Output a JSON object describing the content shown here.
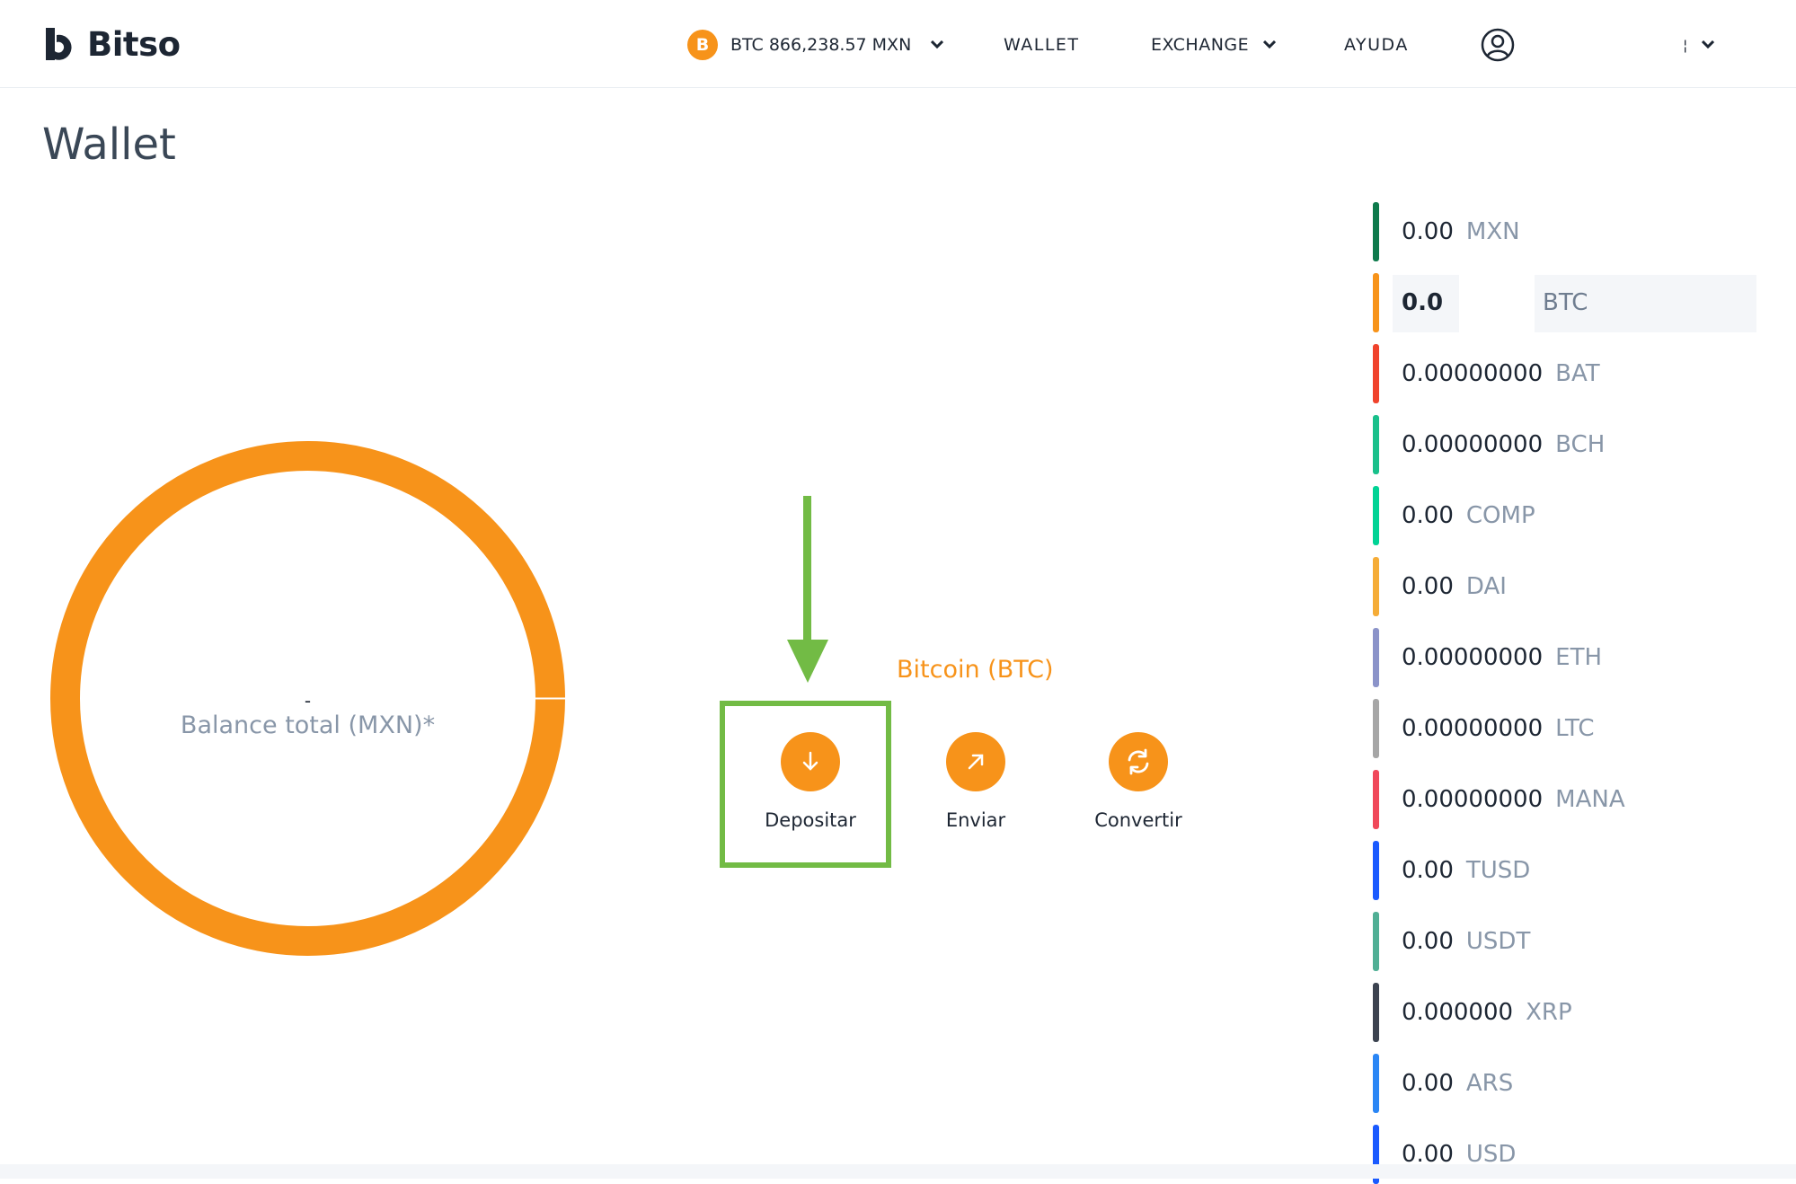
{
  "header": {
    "brand": "Bitso",
    "ticker": {
      "coin_symbol": "B",
      "text": "BTC 866,238.57 MXN"
    },
    "nav": {
      "wallet": "WALLET",
      "exchange": "EXCHANGE",
      "ayuda": "AYUDA"
    },
    "lang_partial": "¦"
  },
  "page": {
    "title": "Wallet"
  },
  "donut": {
    "balance_value": "-",
    "balance_label": "Balance total (MXN)*",
    "color": "#f7931a"
  },
  "currency": {
    "title": "Bitcoin (BTC)",
    "actions": {
      "deposit": "Depositar",
      "send": "Enviar",
      "convert": "Convertir"
    }
  },
  "balances": [
    {
      "amount": "0.00",
      "code": "MXN",
      "color": "#0e7a4c"
    },
    {
      "amount": "0.0",
      "code": "BTC",
      "color": "#f7931a",
      "selected": true
    },
    {
      "amount": "0.00000000",
      "code": "BAT",
      "color": "#f0432c"
    },
    {
      "amount": "0.00000000",
      "code": "BCH",
      "color": "#19c08b"
    },
    {
      "amount": "0.00",
      "code": "COMP",
      "color": "#00d395"
    },
    {
      "amount": "0.00",
      "code": "DAI",
      "color": "#f5ac37"
    },
    {
      "amount": "0.00000000",
      "code": "ETH",
      "color": "#8b93c9"
    },
    {
      "amount": "0.00000000",
      "code": "LTC",
      "color": "#a6a6a6"
    },
    {
      "amount": "0.00000000",
      "code": "MANA",
      "color": "#f0485a"
    },
    {
      "amount": "0.00",
      "code": "TUSD",
      "color": "#1a5aff"
    },
    {
      "amount": "0.00",
      "code": "USDT",
      "color": "#50af95"
    },
    {
      "amount": "0.000000",
      "code": "XRP",
      "color": "#3c4350"
    },
    {
      "amount": "0.00",
      "code": "ARS",
      "color": "#2a86f5"
    },
    {
      "amount": "0.00",
      "code": "USD",
      "color": "#1a5aff"
    }
  ],
  "annotation": {
    "color": "#72bb45"
  }
}
